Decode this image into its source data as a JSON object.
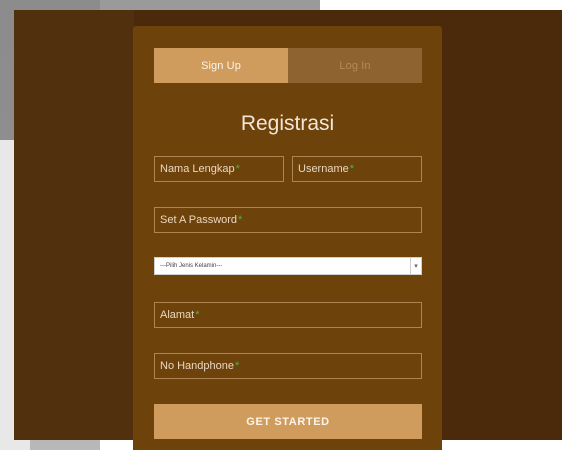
{
  "tabs": {
    "signup": "Sign Up",
    "login": "Log In"
  },
  "form": {
    "title": "Registrasi",
    "required_mark": "*",
    "fields": {
      "full_name": "Nama Lengkap",
      "username": "Username",
      "password": "Set A Password",
      "address": "Alamat",
      "phone": "No Handphone"
    },
    "gender_select": {
      "selected": "---Pilih Jenis Kelamin---"
    },
    "submit": "GET STARTED"
  },
  "colors": {
    "background": "#4a2a0b",
    "panel": "#6e420b",
    "accent": "#cf9c5d",
    "tab_inactive": "#8f6330",
    "required_mark": "#42b94a"
  }
}
